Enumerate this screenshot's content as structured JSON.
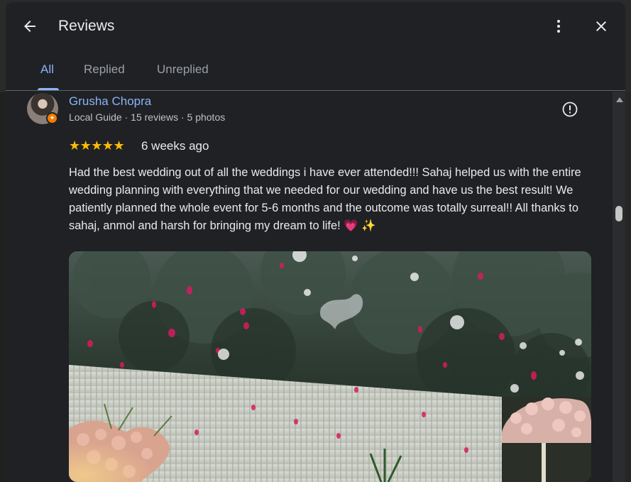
{
  "header": {
    "title": "Reviews",
    "back_icon": "arrow-left-icon",
    "more_icon": "more-vert-icon",
    "close_icon": "close-icon"
  },
  "tabs": [
    {
      "label": "All",
      "active": true
    },
    {
      "label": "Replied",
      "active": false
    },
    {
      "label": "Unreplied",
      "active": false
    }
  ],
  "review": {
    "author": "Grusha Chopra",
    "author_meta": "Local Guide · 15 reviews · 5 photos",
    "stars": "★★★★★",
    "rating": 5,
    "date": "6 weeks ago",
    "text": "Had the best wedding out of all the weddings i have ever attended!!! Sahaj helped us with the entire wedding planning with everything that we needed for our wedding and have us the best result! We patiently planned the whole event for 5-6 months and the outcome was totally surreal!! All thanks to sahaj, anmol and harsh for bringing my dream to life!",
    "emoji_heart": "💗",
    "emoji_sparkle": "✨"
  },
  "colors": {
    "accent": "#8ab4f8",
    "star": "#fbbc04",
    "badge": "#f57c00"
  }
}
